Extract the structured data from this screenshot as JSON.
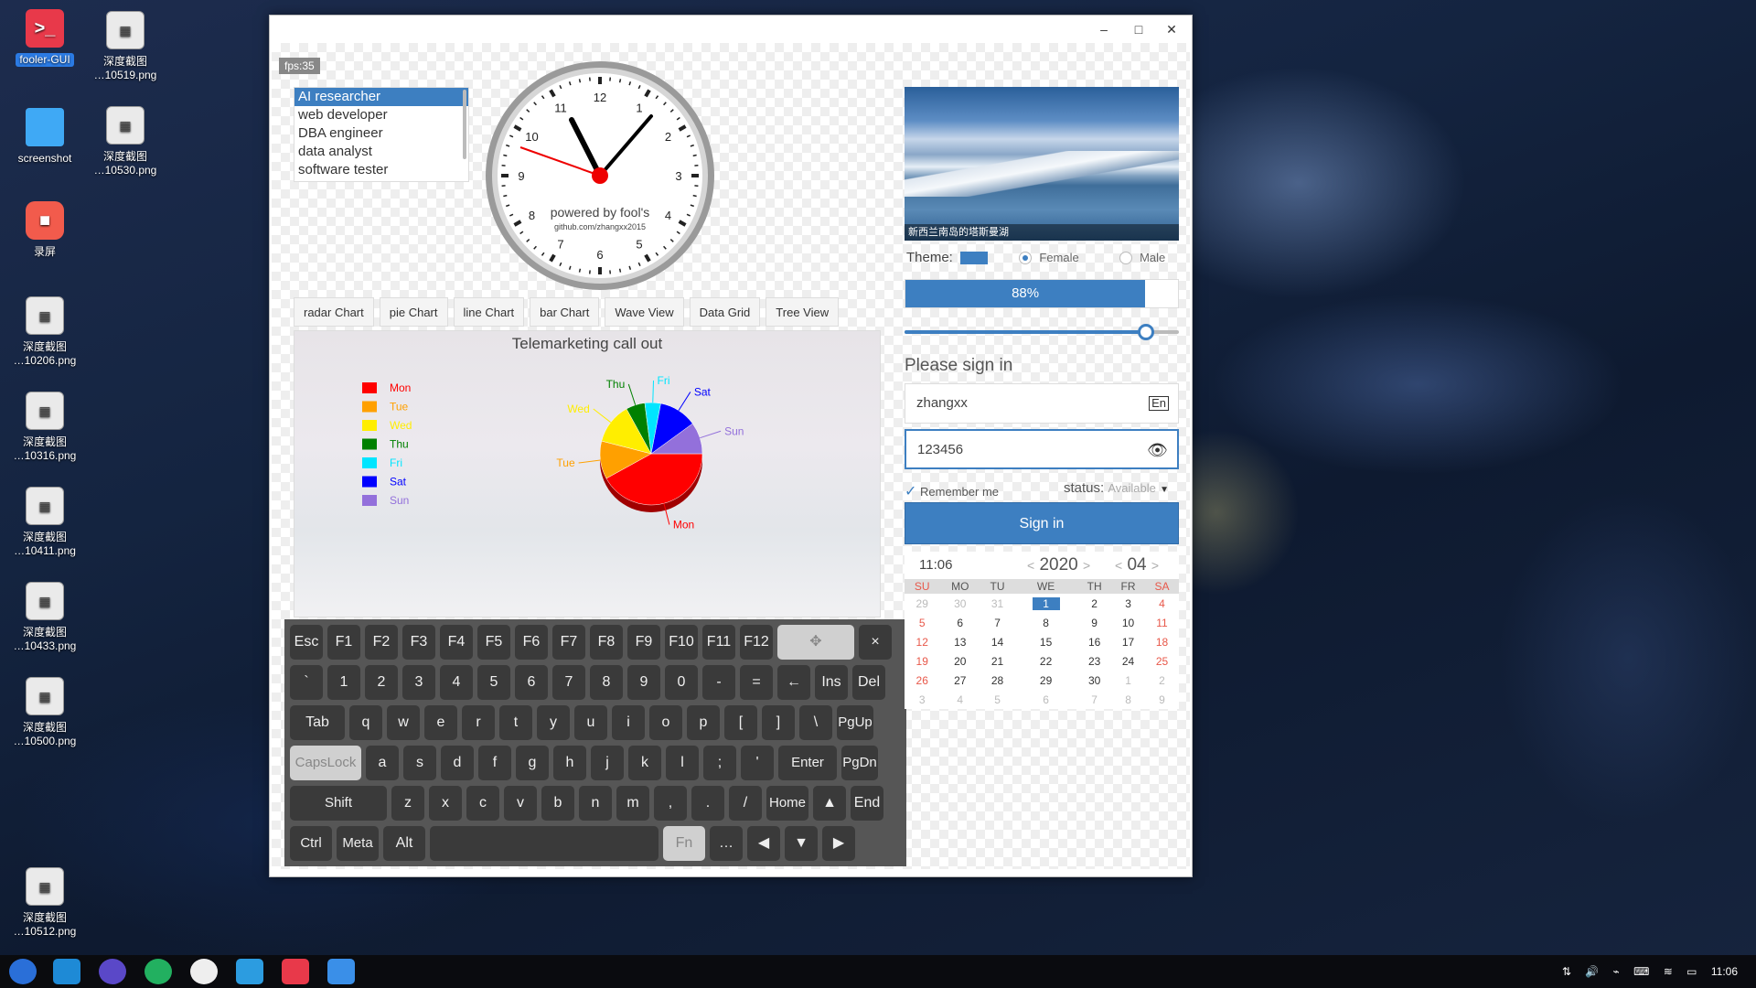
{
  "desktop": {
    "icons": [
      {
        "label": "fooler-GUI",
        "icon": "terminal-icon",
        "glyph": ">_"
      },
      {
        "label": "深度截图\n…20210519.png",
        "short": "深度截图",
        "sub": "…10519.png",
        "icon": "image-file-icon"
      },
      {
        "label": "screenshot",
        "icon": "folder-icon"
      },
      {
        "label": "深度截图",
        "sub": "…10530.png",
        "icon": "image-file-icon"
      },
      {
        "label": "录屏",
        "icon": "screen-record-icon"
      },
      {
        "label": "深度截图",
        "sub": "…10206.png"
      },
      {
        "label": "深度截图",
        "sub": "…10316.png"
      },
      {
        "label": "深度截图",
        "sub": "…10411.png"
      },
      {
        "label": "深度截图",
        "sub": "…10433.png"
      },
      {
        "label": "深度截图",
        "sub": "…10500.png"
      },
      {
        "label": "深度截图",
        "sub": "…10512.png"
      }
    ]
  },
  "window": {
    "controls": {
      "minimize": "–",
      "maximize": "□",
      "close": "✕"
    },
    "fps": "fps:35",
    "job_list": [
      "AI researcher",
      "web developer",
      "DBA engineer",
      "data analyst",
      "software tester"
    ],
    "clock": {
      "caption": "powered by fool's",
      "sub": "github.com/zhangxx2015",
      "numbers": [
        "12",
        "1",
        "2",
        "3",
        "4",
        "5",
        "6",
        "7",
        "8",
        "9",
        "10",
        "11"
      ]
    },
    "tabs": [
      "radar Chart",
      "pie Chart",
      "line Chart",
      "bar Chart",
      "Wave View",
      "Data Grid",
      "Tree View"
    ],
    "chart_title": "Telemarketing call out",
    "keyboard": {
      "row1": [
        "Esc",
        "F1",
        "F2",
        "F3",
        "F4",
        "F5",
        "F6",
        "F7",
        "F8",
        "F9",
        "F10",
        "F11",
        "F12",
        "✥",
        "×"
      ],
      "row2": [
        "`",
        "1",
        "2",
        "3",
        "4",
        "5",
        "6",
        "7",
        "8",
        "9",
        "0",
        "-",
        "=",
        "←",
        "Ins",
        "Del"
      ],
      "row3": [
        "Tab",
        "q",
        "w",
        "e",
        "r",
        "t",
        "y",
        "u",
        "i",
        "o",
        "p",
        "[",
        "]",
        "\\",
        "PgUp"
      ],
      "row4": [
        "CapsLock",
        "a",
        "s",
        "d",
        "f",
        "g",
        "h",
        "j",
        "k",
        "l",
        ";",
        "'",
        "Enter",
        "PgDn"
      ],
      "row5": [
        "Shift",
        "z",
        "x",
        "c",
        "v",
        "b",
        "n",
        "m",
        ",",
        ".",
        "/",
        "Home",
        "▲",
        "End"
      ],
      "row6": [
        "Ctrl",
        "Meta",
        "Alt",
        "",
        "Fn",
        "…",
        "◀",
        "▼",
        "▶"
      ]
    },
    "photo_caption": "新西兰南岛的塔斯曼湖",
    "theme_label": "Theme:",
    "theme_color": "#3d7fc1",
    "gender": {
      "female": "Female",
      "male": "Male",
      "selected": "Female"
    },
    "progress": {
      "text": "88%",
      "value": 0.88
    },
    "slider_value": 0.88,
    "signin": {
      "title": "Please sign in",
      "username": "zhangxx",
      "password": "123456",
      "remember": "Remember me",
      "status_label": "status:",
      "status_value": "Available",
      "button": "Sign in"
    },
    "calendar": {
      "time": "11:06",
      "year": "2020",
      "month": "04",
      "weekdays": [
        "SU",
        "MO",
        "TU",
        "WE",
        "TH",
        "FR",
        "SA"
      ],
      "weeks": [
        [
          "29",
          "30",
          "31",
          "1",
          "2",
          "3",
          "4"
        ],
        [
          "5",
          "6",
          "7",
          "8",
          "9",
          "10",
          "11"
        ],
        [
          "12",
          "13",
          "14",
          "15",
          "16",
          "17",
          "18"
        ],
        [
          "19",
          "20",
          "21",
          "22",
          "23",
          "24",
          "25"
        ],
        [
          "26",
          "27",
          "28",
          "29",
          "30",
          "1",
          "2"
        ],
        [
          "3",
          "4",
          "5",
          "6",
          "7",
          "8",
          "9"
        ]
      ],
      "selected_day": "1"
    }
  },
  "chart_data": {
    "type": "pie",
    "title": "Telemarketing call out",
    "categories": [
      "Mon",
      "Tue",
      "Wed",
      "Thu",
      "Fri",
      "Sat",
      "Sun"
    ],
    "values": [
      42,
      12,
      13,
      6,
      5,
      12,
      10
    ],
    "colors": [
      "#ff0000",
      "#ffa000",
      "#ffee00",
      "#008000",
      "#00e5ff",
      "#0000ff",
      "#9370db"
    ],
    "legend": "left"
  },
  "taskbar": {
    "apps": [
      "launcher-icon",
      "vscode-icon",
      "browser-icon",
      "edge-icon",
      "yinyang-icon",
      "store-icon",
      "terminal-icon",
      "files-icon"
    ],
    "time": "11:06"
  }
}
